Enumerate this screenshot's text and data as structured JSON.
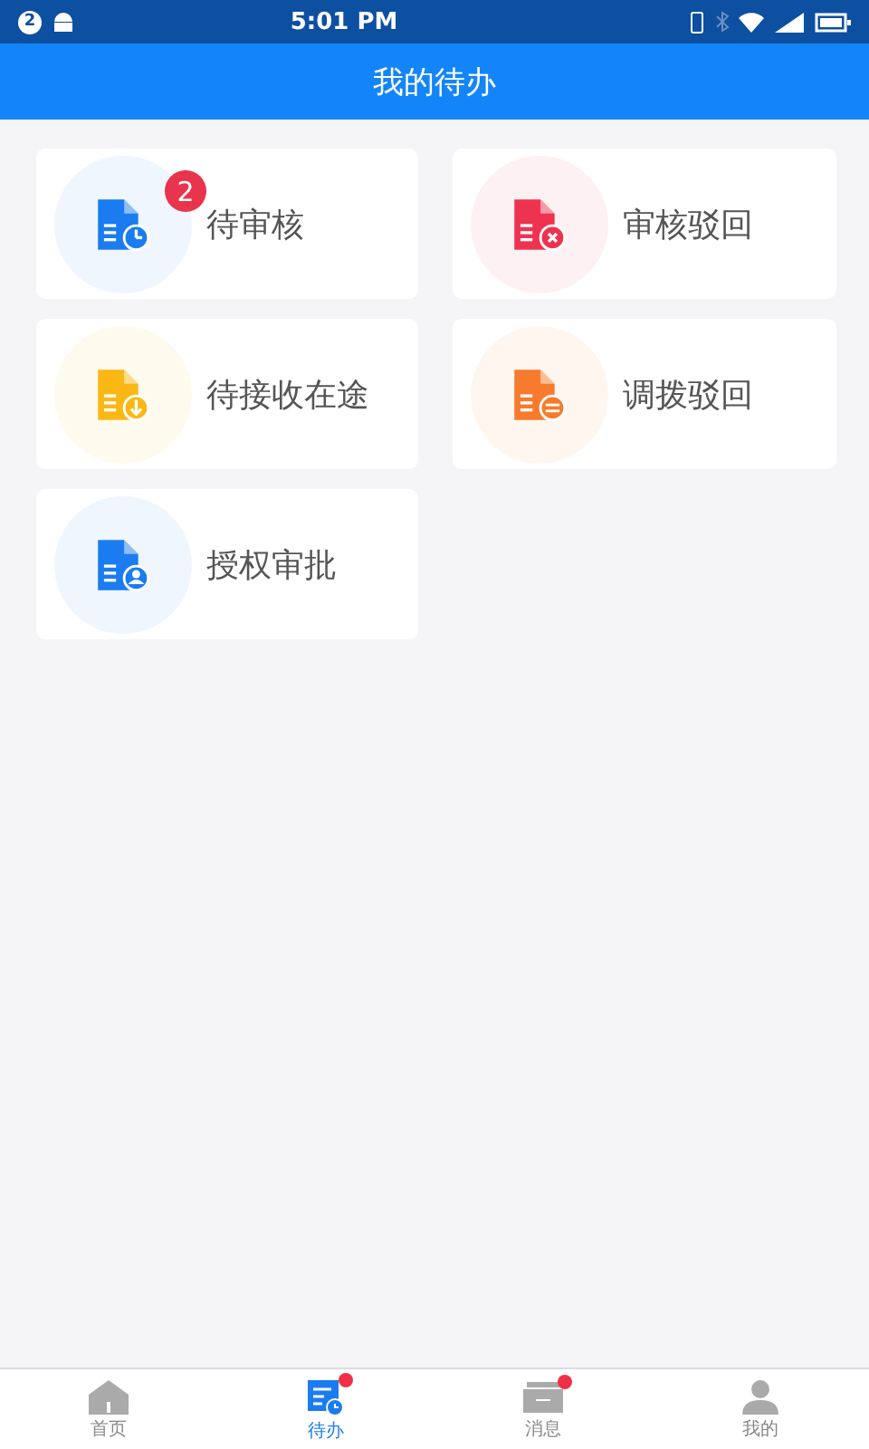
{
  "status_bar": {
    "notification_count": "2",
    "time": "5:01 PM"
  },
  "header": {
    "title": "我的待办"
  },
  "cards": [
    {
      "label": "待审核",
      "kind": "clock",
      "color": "#1a7cf0",
      "badge": "2"
    },
    {
      "label": "审核驳回",
      "kind": "cross",
      "color": "#ee3350"
    },
    {
      "label": "待接收在途",
      "kind": "download",
      "color": "#fbb714"
    },
    {
      "label": "调拨驳回",
      "kind": "swap",
      "color": "#f87a2c"
    },
    {
      "label": "授权审批",
      "kind": "person",
      "color": "#1a7cf0"
    }
  ],
  "tabs": [
    {
      "label": "首页",
      "kind": "home",
      "selected": false,
      "dot": false
    },
    {
      "label": "待办",
      "kind": "todo",
      "selected": true,
      "dot": true
    },
    {
      "label": "消息",
      "kind": "message",
      "selected": false,
      "dot": true
    },
    {
      "label": "我的",
      "kind": "profile",
      "selected": false,
      "dot": false
    }
  ]
}
